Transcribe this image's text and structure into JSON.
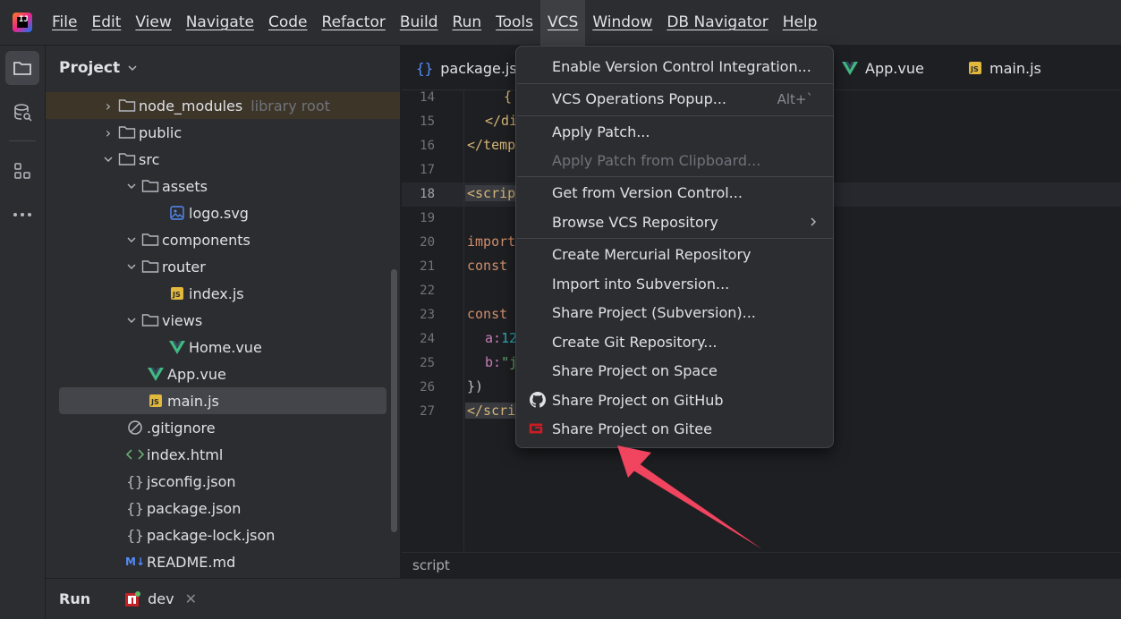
{
  "menubar": {
    "items": [
      "File",
      "Edit",
      "View",
      "Navigate",
      "Code",
      "Refactor",
      "Build",
      "Run",
      "Tools",
      "VCS",
      "Window",
      "DB Navigator",
      "Help"
    ],
    "active": "VCS"
  },
  "toolstrip": {
    "icons": [
      "folder-icon",
      "database-icon",
      "structure-icon",
      "more-icon"
    ]
  },
  "project_panel": {
    "title": "Project",
    "tree": [
      {
        "label": "node_modules",
        "hint": "library root",
        "type": "folder",
        "indent": 0,
        "expanded": false
      },
      {
        "label": "public",
        "type": "folder",
        "indent": 0,
        "expanded": false
      },
      {
        "label": "src",
        "type": "folder",
        "indent": 0,
        "expanded": true
      },
      {
        "label": "assets",
        "type": "folder",
        "indent": 1,
        "expanded": true
      },
      {
        "label": "logo.svg",
        "type": "image",
        "indent": 2
      },
      {
        "label": "components",
        "type": "folder",
        "indent": 1,
        "expanded": true
      },
      {
        "label": "router",
        "type": "folder",
        "indent": 1,
        "expanded": true
      },
      {
        "label": "index.js",
        "type": "js",
        "indent": 2
      },
      {
        "label": "views",
        "type": "folder",
        "indent": 1,
        "expanded": true
      },
      {
        "label": "Home.vue",
        "type": "vue",
        "indent": 2
      },
      {
        "label": "App.vue",
        "type": "vue",
        "indent": 1
      },
      {
        "label": "main.js",
        "type": "js",
        "indent": 1
      },
      {
        "label": ".gitignore",
        "type": "ignore",
        "indent": 0
      },
      {
        "label": "index.html",
        "type": "html",
        "indent": 0
      },
      {
        "label": "jsconfig.json",
        "type": "json",
        "indent": 0
      },
      {
        "label": "package.json",
        "type": "json",
        "indent": 0
      },
      {
        "label": "package-lock.json",
        "type": "json",
        "indent": 0
      },
      {
        "label": "README.md",
        "type": "md",
        "indent": 0
      }
    ]
  },
  "editor": {
    "tabs": [
      "package.jso",
      "App.vue",
      "main.js"
    ],
    "line_numbers": [
      "14",
      "15",
      "16",
      "17",
      "18",
      "19",
      "20",
      "21",
      "22",
      "23",
      "24",
      "25",
      "26",
      "27"
    ],
    "current_line": "18",
    "code": {
      "l14": "{",
      "l15_a": "</di",
      "l16": "</temp",
      "l18": "<scrip",
      "l20": "import",
      "l21": "const",
      "l23": "const",
      "l24_a": "a:",
      "l24_b": "12",
      "l25_a": "b:",
      "l25_b": "\"j",
      "l26": "})",
      "l27": "</scri"
    },
    "breadcrumb": "script"
  },
  "vcs_menu": {
    "enable_integration": "Enable Version Control Integration...",
    "operations_popup": "VCS Operations Popup...",
    "operations_shortcut": "Alt+`",
    "apply_patch": "Apply Patch...",
    "apply_patch_clipboard": "Apply Patch from Clipboard...",
    "get_from_vcs": "Get from Version Control...",
    "browse_repo": "Browse VCS Repository",
    "create_mercurial": "Create Mercurial Repository",
    "import_svn": "Import into Subversion...",
    "share_svn": "Share Project (Subversion)...",
    "create_git": "Create Git Repository...",
    "share_space": "Share Project on Space",
    "share_github": "Share Project on GitHub",
    "share_gitee": "Share Project on Gitee"
  },
  "runbar": {
    "title": "Run",
    "tab": "dev"
  },
  "colors": {
    "accent_vue": "#41b883",
    "js_badge": "#e2b93d",
    "gitee_red": "#c71d23",
    "arrow": "#f0445f"
  }
}
